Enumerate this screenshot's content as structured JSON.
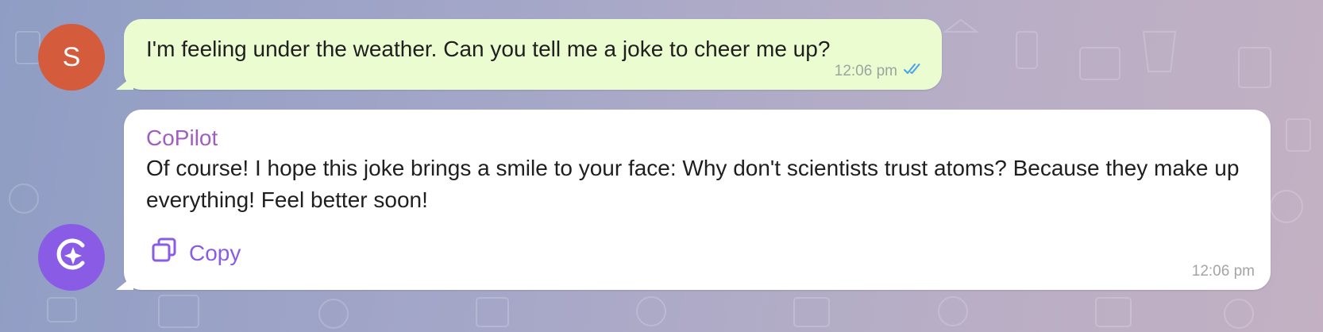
{
  "background": {
    "colors": [
      "#8f9dc4",
      "#c3b0c3"
    ]
  },
  "messages": [
    {
      "avatar_letter": "S",
      "avatar_color": "#d45b3b",
      "text": "I'm feeling under the weather. Can you tell me a joke to cheer me up?",
      "time": "12:06 pm",
      "status_icon": "double-check-icon",
      "bubble_color": "#eafcd0"
    },
    {
      "sender": "CoPilot",
      "sender_color": "#a05fc0",
      "avatar_icon": "copilot-logo-icon",
      "avatar_color": "#8a5ce6",
      "text": "Of course! I hope this joke brings a smile to your face: Why don't scientists trust atoms? Because they make up everything! Feel better soon!",
      "copy_label": "Copy",
      "copy_icon": "copy-icon",
      "time": "12:06 pm",
      "bubble_color": "#ffffff"
    }
  ]
}
